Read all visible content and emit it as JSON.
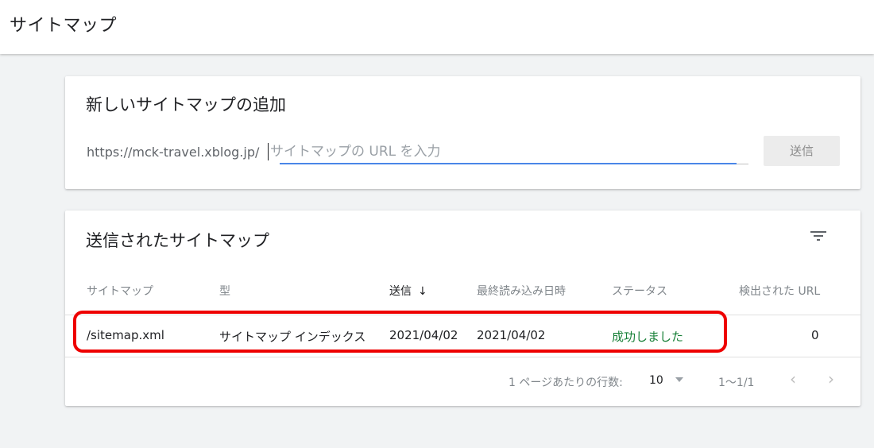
{
  "header": {
    "title": "サイトマップ"
  },
  "add_card": {
    "title": "新しいサイトマップの追加",
    "url_prefix": "https://mck-travel.xblog.jp/",
    "input_value": "",
    "input_placeholder": "サイトマップの URL を入力",
    "submit_label": "送信"
  },
  "submitted_card": {
    "title": "送信されたサイトマップ",
    "filter_icon": "filter-icon",
    "columns": {
      "sitemap": "サイトマップ",
      "type": "型",
      "submitted": "送信",
      "last_read": "最終読み込み日時",
      "status": "ステータス",
      "discovered_urls": "検出された URL"
    },
    "sort_indicator": "↓",
    "rows": [
      {
        "sitemap": "/sitemap.xml",
        "type": "サイトマップ インデックス",
        "submitted": "2021/04/02",
        "last_read": "2021/04/02",
        "status": "成功しました",
        "discovered_urls": "0"
      }
    ],
    "pagination": {
      "rows_per_page_label": "1 ページあたりの行数:",
      "rows_per_page_value": "10",
      "range": "1～1/1",
      "prev_icon": "‹",
      "next_icon": "›"
    }
  },
  "colors": {
    "success": "#188038",
    "accent_underline": "#4a86e8",
    "highlight": "#ee0000"
  }
}
